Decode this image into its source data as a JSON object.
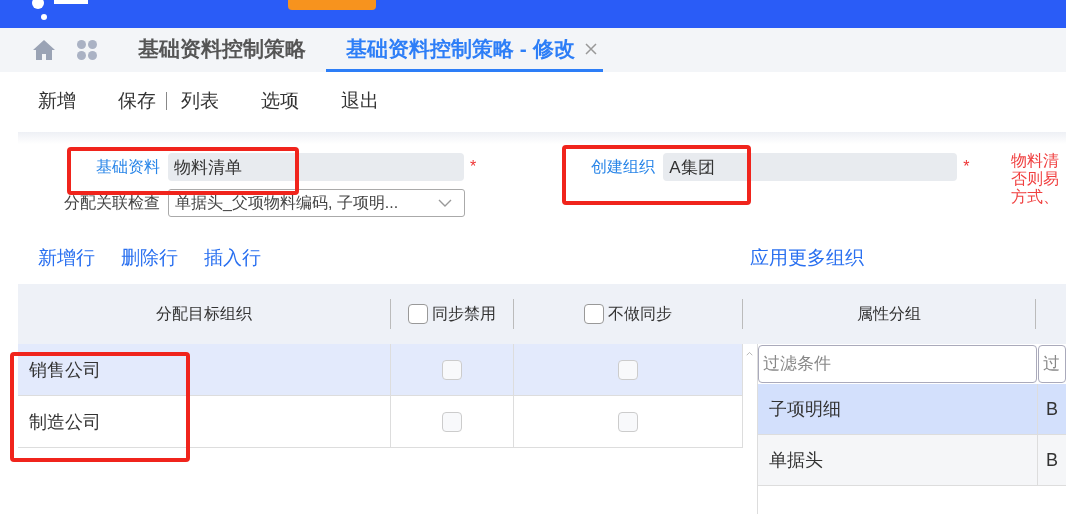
{
  "tabs": [
    {
      "label": "基础资料控制策略",
      "selected": false,
      "closable": false
    },
    {
      "label": "基础资料控制策略 - 修改",
      "selected": true,
      "closable": true
    }
  ],
  "toolbar": [
    {
      "label": "新增",
      "separator_after": false
    },
    {
      "label": "保存",
      "separator_after": true
    },
    {
      "label": "列表",
      "separator_after": false
    },
    {
      "label": "选项",
      "separator_after": false
    },
    {
      "label": "退出",
      "separator_after": false
    }
  ],
  "form": {
    "basic_data": {
      "label": "基础资料",
      "value": "物料清单",
      "required_mark": "*"
    },
    "create_org": {
      "label": "创建组织",
      "value": "A集团",
      "required_mark": "*"
    },
    "assign_check": {
      "label": "分配关联检查",
      "value": "单据头_父项物料编码, 子项明..."
    },
    "note_lines": [
      "物料清",
      "否则易",
      "方式、"
    ]
  },
  "row_actions": [
    "新增行",
    "删除行",
    "插入行"
  ],
  "more_orgs_link": "应用更多组织",
  "org_table": {
    "columns": [
      {
        "label": "分配目标组织",
        "kind": "text"
      },
      {
        "label": "同步禁用",
        "kind": "checkbox",
        "checked": false
      },
      {
        "label": "不做同步",
        "kind": "checkbox",
        "checked": false
      }
    ],
    "rows": [
      {
        "org": "销售公司",
        "selected": true,
        "sync_disabled": false,
        "no_sync": false
      },
      {
        "org": "制造公司",
        "selected": false,
        "sync_disabled": false,
        "no_sync": false
      }
    ]
  },
  "attr_panel": {
    "columns": [
      "属性分组"
    ],
    "filters": [
      {
        "placeholder": "过滤条件"
      },
      {
        "placeholder": "过"
      }
    ],
    "rows": [
      {
        "group": "子项明细",
        "column_2": "B",
        "selected": true
      },
      {
        "group": "单据头",
        "column_2": "B",
        "selected": false
      }
    ]
  }
}
